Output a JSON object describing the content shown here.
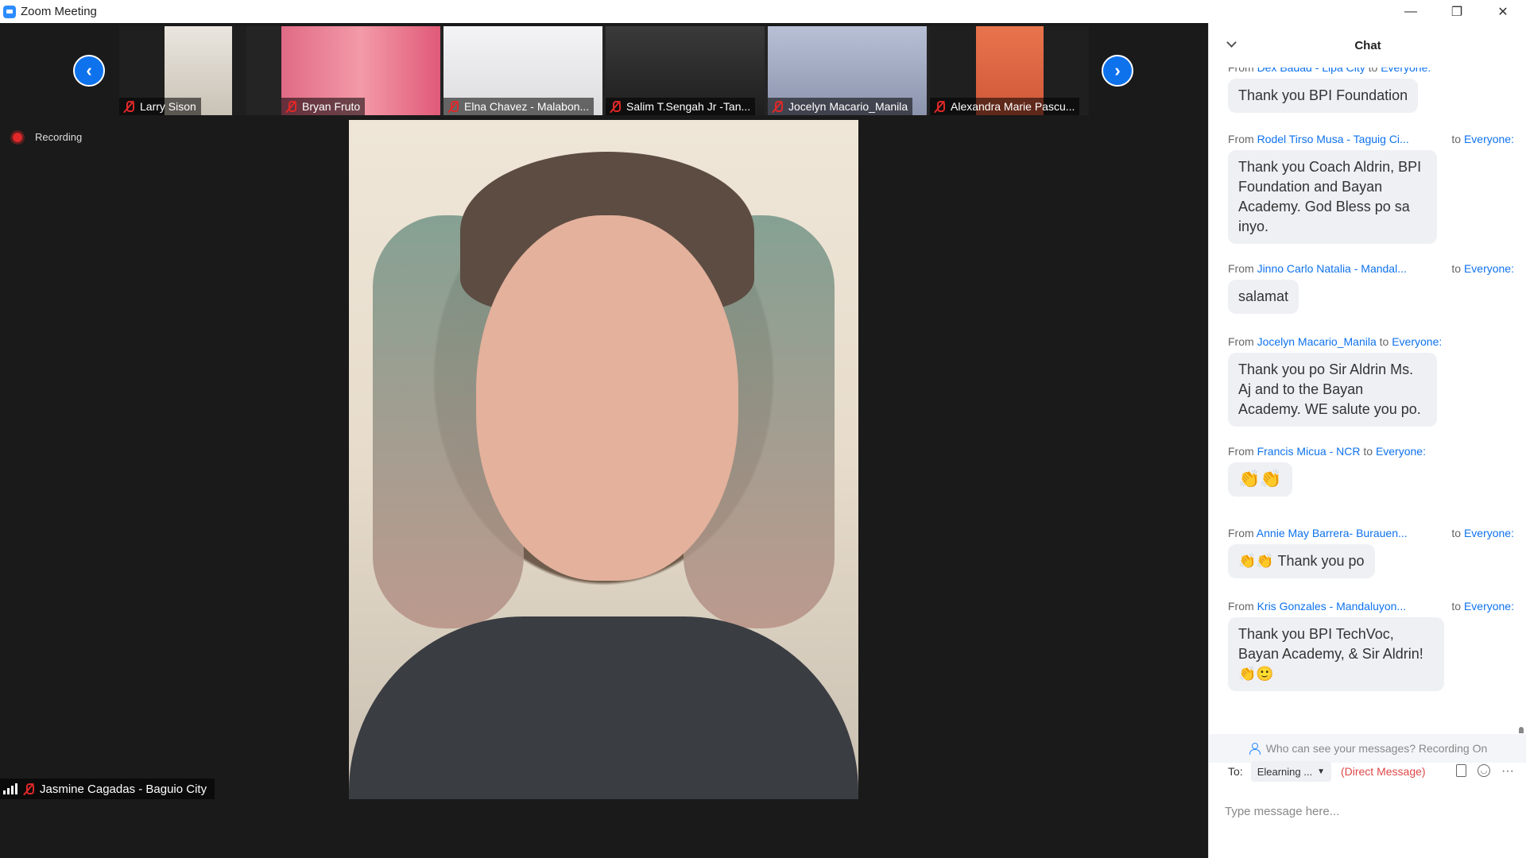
{
  "window": {
    "title": "Zoom Meeting",
    "controls": [
      "—",
      "❐",
      "✕"
    ]
  },
  "meeting": {
    "recording_label": "Recording",
    "prev_icon": "chevron-left-icon",
    "next_icon": "chevron-right-icon",
    "participants": [
      {
        "name": "Larry Sison",
        "muted": true,
        "bg": "#e9e4dc"
      },
      {
        "name": "Bryan Fruto",
        "muted": true,
        "bg": "#e05a78"
      },
      {
        "name": "Elna Chavez - Malabon...",
        "muted": true,
        "bg": "#e8e8ea"
      },
      {
        "name": "Salim T.Sengah Jr -Tan...",
        "muted": true,
        "bg": "#2a2a2a"
      },
      {
        "name": "Jocelyn Macario_Manila",
        "muted": true,
        "bg": "#a8b0c8"
      },
      {
        "name": "Alexandra Marie Pascu...",
        "muted": true,
        "bg": "#e06a44"
      }
    ],
    "active_speaker": "Jasmine Cagadas - Baguio City"
  },
  "chat": {
    "title": "Chat",
    "messages": [
      {
        "from": "Dex Badad - Lipa City",
        "to": "Everyone:",
        "text": "Thank you BPI Foundation"
      },
      {
        "from": "Rodel Tirso Musa - Taguig Ci...",
        "to": "Everyone:",
        "text": "Thank you Coach Aldrin, BPI Foundation and Bayan Academy. God Bless po sa inyo."
      },
      {
        "from": "Jinno Carlo Natalia - Mandal...",
        "to": "Everyone:",
        "text": "salamat"
      },
      {
        "from": "Jocelyn Macario_Manila",
        "to": "Everyone:",
        "text": "Thank you po Sir Aldrin Ms. Aj and to the Bayan Academy. WE salute you po."
      },
      {
        "from": "Francis Micua - NCR",
        "to": "Everyone:",
        "text": "👏👏"
      },
      {
        "from": "Annie May Barrera- Burauen...",
        "to": "Everyone:",
        "text": "👏👏 Thank you po"
      },
      {
        "from": "Kris Gonzales - Mandaluyon...",
        "to": "Everyone:",
        "text": "Thank you BPI TechVoc, Bayan Academy, & Sir Aldrin! 👏🙂"
      }
    ],
    "from_prefix": "From",
    "to_word": "to",
    "notice": "Who can see your messages? Recording On",
    "to_label": "To:",
    "recipient": "Elearning ...",
    "direct_message": "(Direct Message)",
    "input_placeholder": "Type message here..."
  }
}
